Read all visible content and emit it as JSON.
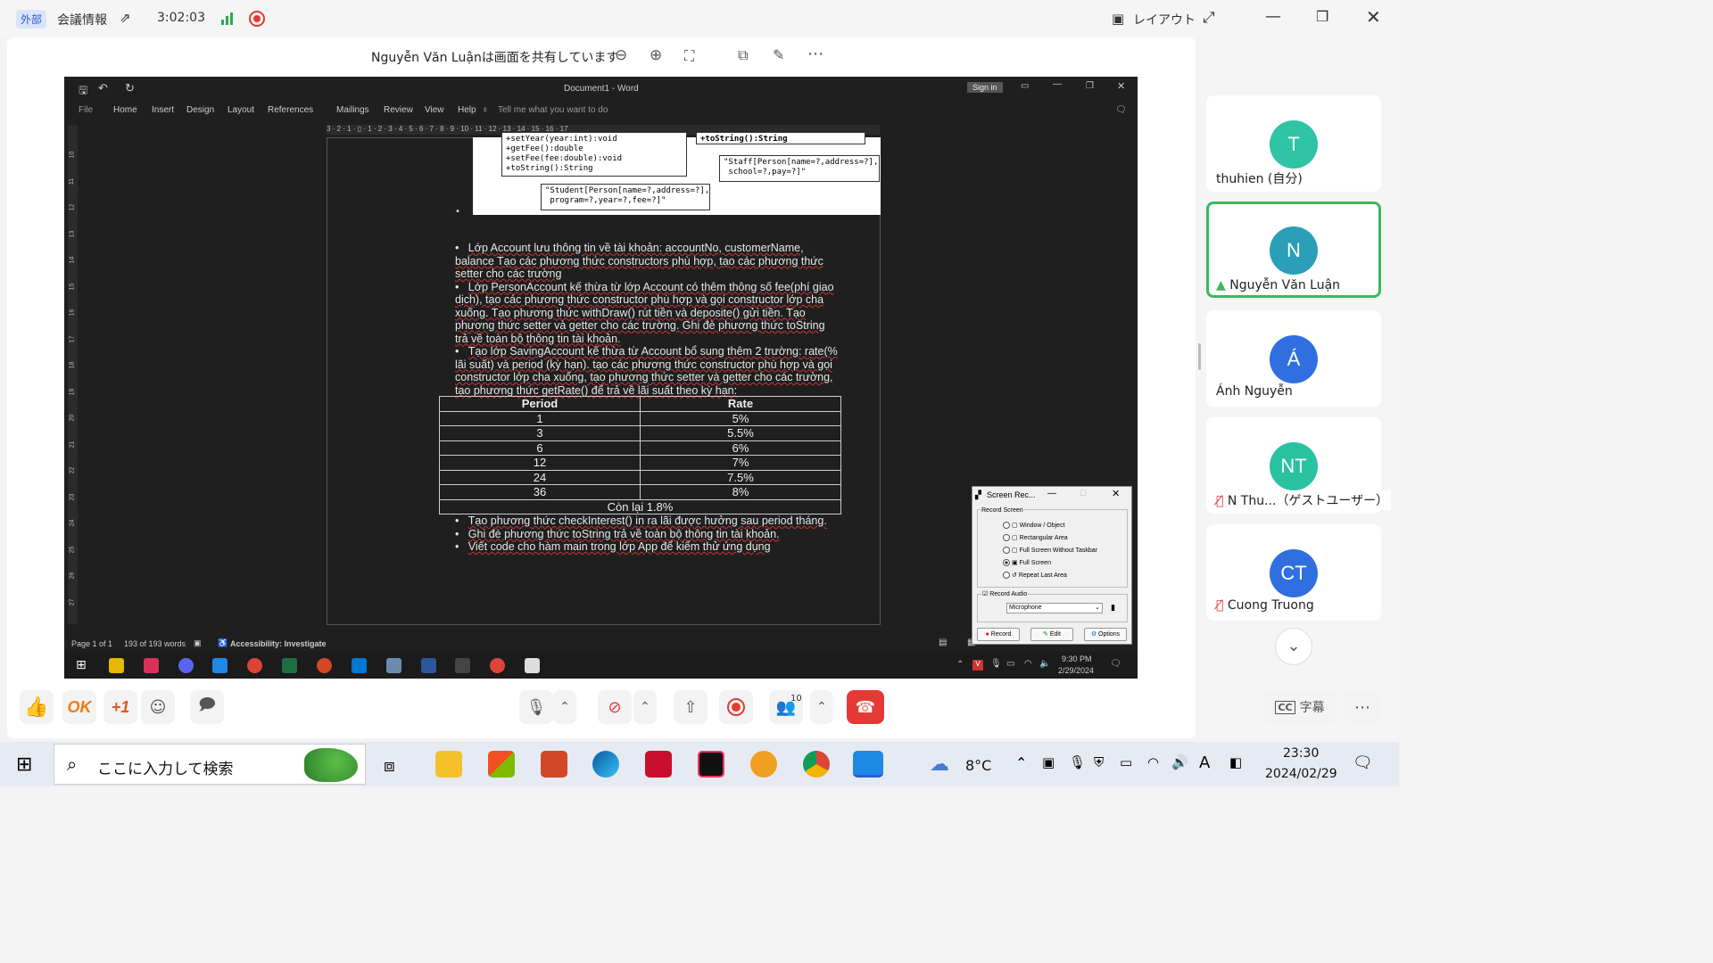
{
  "teams_top": {
    "external_badge": "外部",
    "meeting_info": "会議情報",
    "elapsed_time": "3:02:03",
    "layout_label": "レイアウト"
  },
  "share_bar": {
    "sharing_text": "Nguyễn Văn Luậnは画面を共有しています"
  },
  "word": {
    "doc_title": "Document1  -  Word",
    "sign_in": "Sign in",
    "menu": [
      "File",
      "Home",
      "Insert",
      "Design",
      "Layout",
      "References",
      "Mailings",
      "Review",
      "View",
      "Help"
    ],
    "tell_me": "Tell me what you want to do",
    "ruler_top": "3 · 2 · 1 · ▯ · 1 · 2 · 3 · 4 · 5 · 6 · 7 · 8 · 9 · 10 · 11 · 12 · 13 · 14 · 15 · 16 · 17",
    "ruler_left": [
      "10",
      "11",
      "12",
      "13",
      "14",
      "15",
      "16",
      "17",
      "18",
      "19",
      "20",
      "21",
      "22",
      "23",
      "24",
      "25",
      "26",
      "27"
    ],
    "uml": {
      "box1": "+setYear(year:int):void\n+getFee():double\n+setFee(fee:double):void\n+toString():String",
      "box2": "+toString():String",
      "note_staff": "\"Staff[Person[name=?,address=?],\n school=?,pay=?]\"",
      "note_student": "\"Student[Person[name=?,address=?],\n program=?,year=?,fee=?]\""
    },
    "paragraphs": [
      "Lớp Account lưu thông tin về tài khoản: accountNo, customerName, balance Tạo các phương thức constructors phù hợp, tạo các phương thức setter cho các trường",
      "Lớp PersonAccount kế thừa từ lớp Account có thêm thông số fee(phí giao dịch), tạo các phương thức constructor phù hợp và gọi constructor lớp cha xuống. Tạo phương thức withDraw() rút tiền và deposite() gửi tiền. Tạo phương thức setter và getter cho các trường. Ghi đè phương thức toString trả về toàn bộ thông tin tài khoản.",
      "Tạo lớp SavingAccount kế thừa từ Account bổ sung thêm 2 trường: rate(% lãi suất) và period (kỳ hạn). tạo các phương thức constructor phù hợp và gọi constructor lớp cha xuống, tạo phương thức setter và getter cho các trường, tạo phương thức getRate() để trả về lãi suất theo kỳ hạn:"
    ],
    "table": {
      "headers": [
        "Period",
        "Rate"
      ],
      "rows": [
        [
          "1",
          "5%"
        ],
        [
          "3",
          "5.5%"
        ],
        [
          "6",
          "6%"
        ],
        [
          "12",
          "7%"
        ],
        [
          "24",
          "7.5%"
        ],
        [
          "36",
          "8%"
        ]
      ],
      "footer": "Còn lại 1.8%"
    },
    "bullets_after": [
      "Tạo phương thức checkInterest() in ra lãi được hưởng sau period tháng.",
      "Ghi đè phương thức toString trả về toàn bộ thông tin tài khoản.",
      "Viết code cho hàm main trong lớp App để kiểm thử ứng dụng"
    ],
    "status": {
      "page": "Page 1 of 1",
      "words": "193 of 193 words",
      "accessibility": "Accessibility: Investigate"
    }
  },
  "recorder": {
    "title": "Screen Rec...",
    "group_record": "Record Screen",
    "options": [
      "Window / Object",
      "Rectangular Area",
      "Full Screen Without Taskbar",
      "Full Screen",
      "Repeat Last Area"
    ],
    "selected": "Full Screen",
    "audio_label": "Record Audio",
    "audio_source": "Microphone",
    "btn_record": "Record",
    "btn_edit": "Edit",
    "btn_options": "Options"
  },
  "remote_clock": {
    "time": "9:30 PM",
    "date": "2/29/2024"
  },
  "participants": [
    {
      "initials": "T",
      "name": "thuhien (自分)",
      "color": "#2ec4a5"
    },
    {
      "initials": "N",
      "name": "Nguyễn Văn Luận",
      "color": "#2a9fb7"
    },
    {
      "initials": "Á",
      "name": "Ánh Nguyễn",
      "color": "#2f6fe0"
    },
    {
      "initials": "NT",
      "name": "N Thu...（ゲストユーザー）",
      "color": "#28c2a0"
    },
    {
      "initials": "CT",
      "name": "Cuong Truong",
      "color": "#2f6fe0"
    }
  ],
  "controls": {
    "ok_label": "OK",
    "plus_one": "+1",
    "participant_count": "10",
    "captions_label": "字幕"
  },
  "taskbar": {
    "search_placeholder": "ここに入力して検索",
    "weather": "8°C",
    "ime": "A",
    "time": "23:30",
    "date": "2024/02/29"
  },
  "colors": {
    "active_speaker": "#3cb95a",
    "leave_button": "#e53935",
    "record_red": "#e53935"
  }
}
